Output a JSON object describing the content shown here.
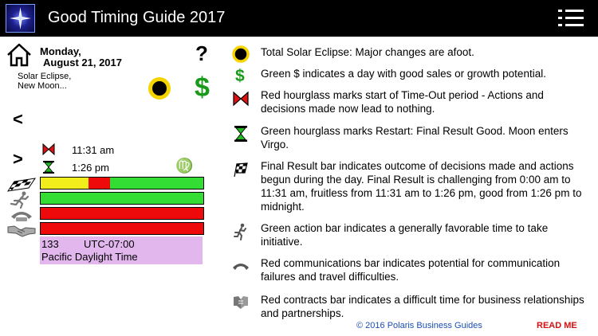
{
  "app": {
    "title": "Good Timing Guide 2017"
  },
  "day": {
    "weekday": "Monday,",
    "date": "August 21, 2017",
    "desc_line1": "Solar Eclipse,",
    "desc_line2": "New Moon..."
  },
  "nav": {
    "help": "?",
    "prev": "<",
    "next": ">"
  },
  "times": {
    "timeout": "11:31 am",
    "restart": "1:26 pm",
    "sign_glyph": "♍"
  },
  "bars": {
    "final": [
      {
        "color": "#f2ee1c",
        "fraction": 0.293
      },
      {
        "color": "#ee0a0a",
        "fraction": 0.135
      },
      {
        "color": "#33dd33",
        "fraction": 0.572
      }
    ],
    "action": "#33dd33",
    "communications": "#ee0a0a",
    "contracts": "#ee0a0a"
  },
  "timezone": {
    "number": "133",
    "offset": "UTC-07:00",
    "name": "Pacific Daylight Time"
  },
  "legend": [
    {
      "icon": "eclipse-icon",
      "text": "Total Solar Eclipse: Major changes are afoot."
    },
    {
      "icon": "dollar-icon",
      "text": "Green $ indicates a day with good sales or growth potential."
    },
    {
      "icon": "red-hourglass-icon",
      "text": "Red hourglass marks start of Time-Out period - Actions and decisions made now lead to nothing."
    },
    {
      "icon": "green-hourglass-icon",
      "text": "Green hourglass marks Restart: Final Result Good. Moon enters Virgo."
    },
    {
      "icon": "checkered-flag-icon",
      "text": "Final Result bar indicates outcome of decisions made and actions begun during the day. Final Result is challenging from 0:00 am to 11:31 am, fruitless from 11:31 am to 1:26 pm, good from 1:26 pm to midnight."
    },
    {
      "icon": "runner-icon",
      "text": "Green action bar indicates a generally favorable time to take initiative."
    },
    {
      "icon": "phone-icon",
      "text": "Red communications bar indicates potential for communication failures and travel difficulties."
    },
    {
      "icon": "handshake-icon",
      "text": "Red contracts bar indicates a difficult time for business relationships and partnerships."
    }
  ],
  "footer": {
    "copyright": "© 2016 Polaris Business Guides",
    "read_me": "READ ME"
  }
}
